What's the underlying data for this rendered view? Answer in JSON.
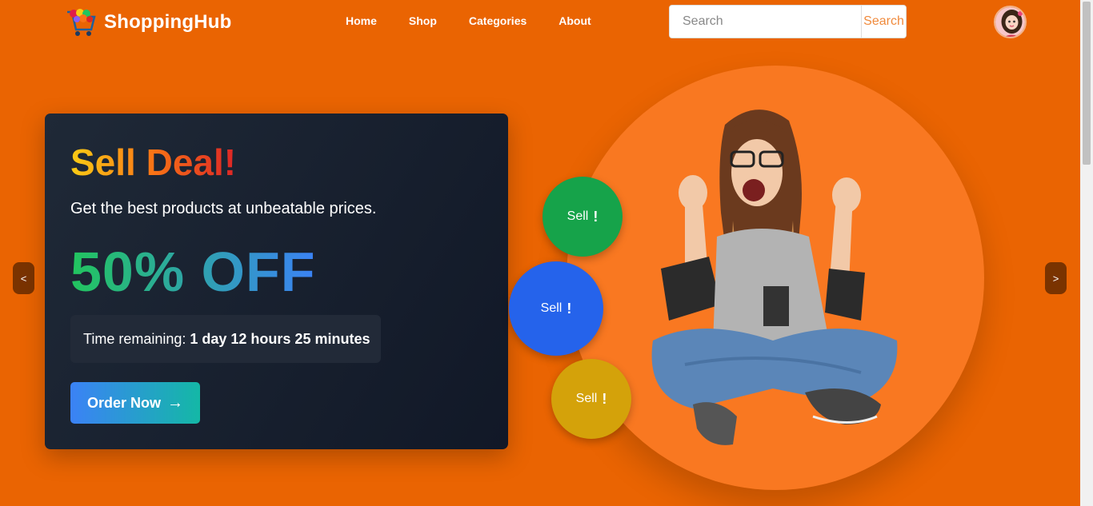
{
  "header": {
    "brand": "ShoppingHub",
    "nav": [
      "Home",
      "Shop",
      "Categories",
      "About"
    ],
    "search": {
      "placeholder": "Search",
      "button": "Search"
    }
  },
  "carousel": {
    "prev": "<",
    "next": ">"
  },
  "promo": {
    "heading": "Sell Deal!",
    "subtitle": "Get the best products at unbeatable prices.",
    "discount": "50% OFF",
    "timer_label": "Time remaining:",
    "timer_value": "1 day 12 hours 25 minutes",
    "cta": "Order Now"
  },
  "bubbles": [
    {
      "label": "Sell",
      "mark": "!",
      "color": "#16a34a"
    },
    {
      "label": "Sell",
      "mark": "!",
      "color": "#2563eb"
    },
    {
      "label": "Sell",
      "mark": "!",
      "color": "#d4a20a"
    }
  ],
  "colors": {
    "background": "#ea6402",
    "hero_circle": "#f97821",
    "card": "#1f2937"
  }
}
